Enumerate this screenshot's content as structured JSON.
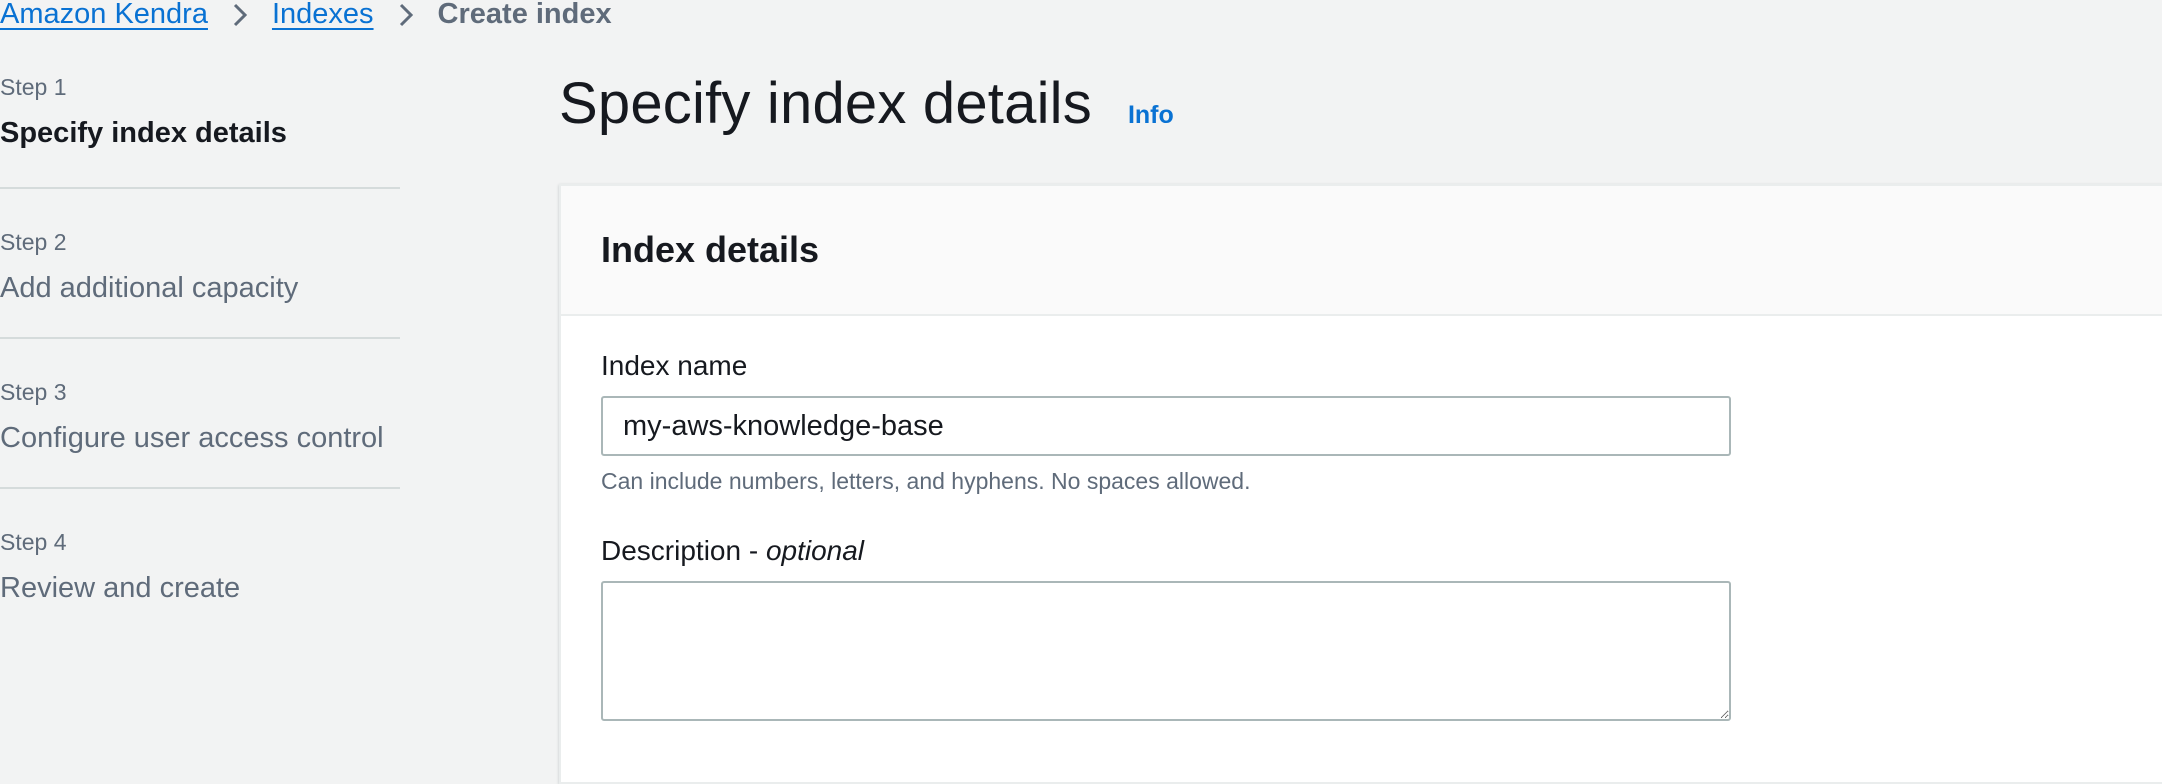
{
  "breadcrumb": {
    "items": [
      {
        "label": "Amazon Kendra"
      },
      {
        "label": "Indexes"
      },
      {
        "label": "Create index"
      }
    ]
  },
  "steps": [
    {
      "number": "Step 1",
      "title": "Specify index details",
      "active": true
    },
    {
      "number": "Step 2",
      "title": "Add additional capacity",
      "active": false
    },
    {
      "number": "Step 3",
      "title": "Configure user access control",
      "active": false
    },
    {
      "number": "Step 4",
      "title": "Review and create",
      "active": false
    }
  ],
  "page": {
    "title": "Specify index details",
    "info_label": "Info"
  },
  "panel": {
    "title": "Index details",
    "index_name": {
      "label": "Index name",
      "value": "my-aws-knowledge-base",
      "constraint": "Can include numbers, letters, and hyphens. No spaces allowed."
    },
    "description": {
      "label": "Description - ",
      "label_optional": "optional",
      "value": ""
    }
  },
  "colors": {
    "link": "#0972d3",
    "background": "#f2f3f3",
    "text": "#16191f",
    "secondary_text": "#5f6b7a"
  }
}
